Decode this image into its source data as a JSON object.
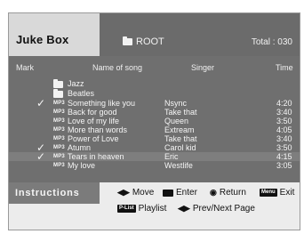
{
  "header": {
    "title": "Juke Box",
    "folder": "ROOT",
    "total": "Total : 030"
  },
  "columns": {
    "mark": "Mark",
    "name": "Name of song",
    "singer": "Singer",
    "time": "Time"
  },
  "folders": [
    {
      "label": "Jazz"
    },
    {
      "label": "Beatles"
    }
  ],
  "songs": [
    {
      "marked": true,
      "tag": "MP3",
      "name": "Something like you",
      "singer": "Nsync",
      "time": "4:20"
    },
    {
      "marked": false,
      "tag": "MP3",
      "name": "Back for good",
      "singer": "Take that",
      "time": "3:40"
    },
    {
      "marked": false,
      "tag": "MP3",
      "name": "Love of my life",
      "singer": "Queen",
      "time": "3:50"
    },
    {
      "marked": false,
      "tag": "MP3",
      "name": "More than words",
      "singer": "Extream",
      "time": "4:05"
    },
    {
      "marked": false,
      "tag": "MP3",
      "name": "Power of Love",
      "singer": "Take that",
      "time": "3:40"
    },
    {
      "marked": true,
      "tag": "MP3",
      "name": "Atumn",
      "singer": "Carol kid",
      "time": "3:50"
    },
    {
      "marked": true,
      "tag": "MP3",
      "name": "Tears in heaven",
      "singer": "Eric",
      "time": "4:15",
      "highlighted": true
    },
    {
      "marked": false,
      "tag": "MP3",
      "name": "My love",
      "singer": "Westlife",
      "time": "3:05"
    }
  ],
  "check_mark": "✓",
  "instructions": {
    "label": "Instructions",
    "move_sym": "◀▶",
    "move": "Move",
    "enter": "Enter",
    "return_sym": "◉",
    "return": "Return",
    "menu_key": "Menu",
    "exit": "Exit",
    "plist_key": "P-List",
    "playlist": "Playlist",
    "page_sym": "◀▶",
    "page": "Prev/Next Page"
  }
}
